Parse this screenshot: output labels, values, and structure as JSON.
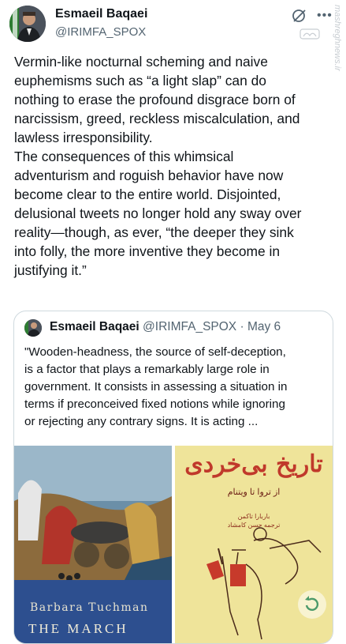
{
  "author": {
    "name": "Esmaeil Baqaei",
    "handle": "@IRIMFA_SPOX"
  },
  "watermark": "mashreghnews.ir",
  "icons": {
    "grok": "grok-icon",
    "more": "more-icon",
    "replay": "replay-icon"
  },
  "tweet_text": "Vermin-like nocturnal scheming and naive\neuphemisms such as “a light slap” can do\nnothing to erase the profound disgrace born of\nnarcissism, greed, reckless miscalculation, and\nlawless irresponsibility.\nThe consequences of this whimsical\nadventurism and roguish behavior have now\nbecome clear to the entire world. Disjointed,\ndelusional tweets no longer hold any sway over\nreality—though, as ever, “the deeper they sink\ninto folly, the more inventive they become in\njustifying it.”",
  "quote": {
    "name": "Esmaeil Baqaei",
    "handle": "@IRIMFA_SPOX",
    "separator": "·",
    "date": "May 6",
    "text": "\"Wooden-headness, the source of self-deception,\nis a factor that plays a remarkably large role in\ngovernment. It consists in assessing a situation in\nterms if preconceived fixed notions while ignoring\nor rejecting any contrary signs. It is acting ...",
    "book1": {
      "author": "Barbara Tuchman",
      "title": "THE MARCH"
    },
    "book2": {
      "title": "تاریخ بی‌خردی",
      "subtitle": "از تروا تا ویتنام",
      "author": "باربارا تاکمن",
      "translator": "ترجمه حسن کامشاد"
    }
  },
  "colors": {
    "text": "#0f1419",
    "secondary": "#536471",
    "border": "#cfd9de",
    "book2_bg": "#efe49a",
    "book2_title": "#c0392b"
  }
}
